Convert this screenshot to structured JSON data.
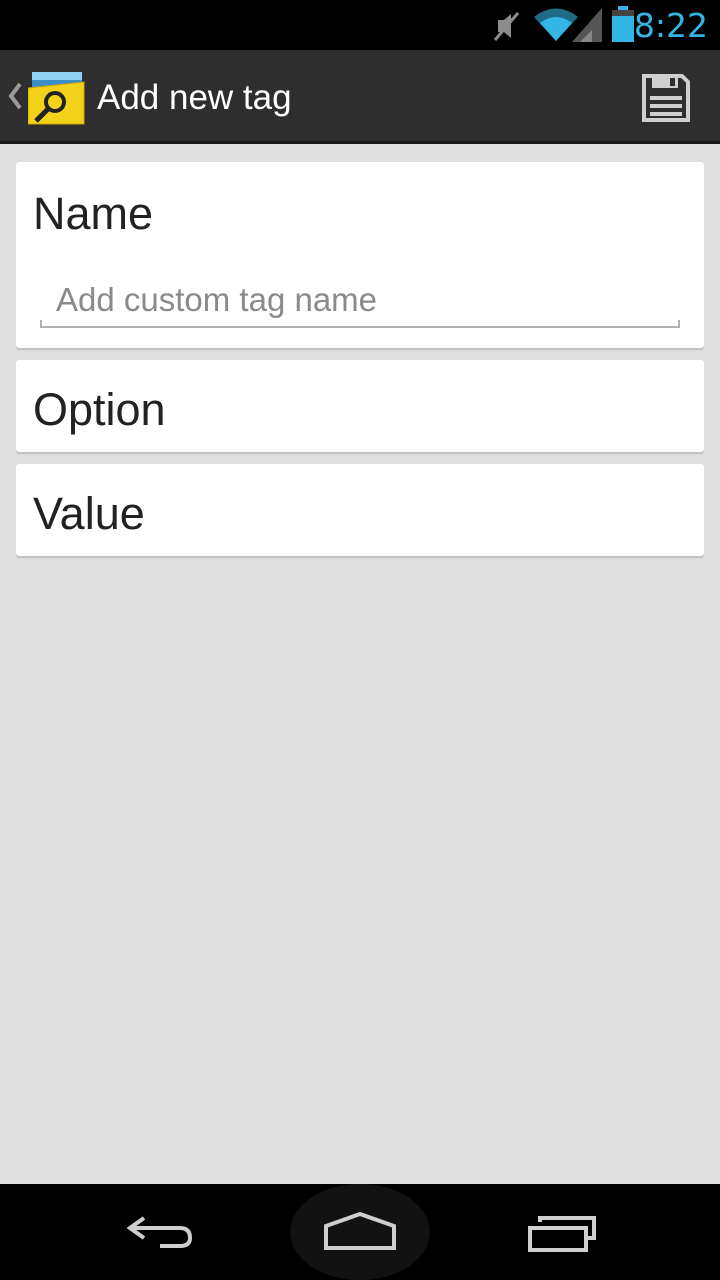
{
  "status_bar": {
    "time": "8:22",
    "icons": [
      "muted-icon",
      "wifi-icon",
      "signal-icon",
      "battery-icon"
    ],
    "accent_color": "#33b5e5"
  },
  "action_bar": {
    "title": "Add new tag",
    "icons": [
      "up-caret-icon",
      "app-icon",
      "save-icon"
    ]
  },
  "form": {
    "name": {
      "label": "Name",
      "placeholder": "Add custom tag name",
      "value": ""
    },
    "option": {
      "label": "Option"
    },
    "value": {
      "label": "Value"
    }
  },
  "nav_bar": {
    "icons": [
      "back-icon",
      "home-icon",
      "recent-apps-icon"
    ]
  }
}
